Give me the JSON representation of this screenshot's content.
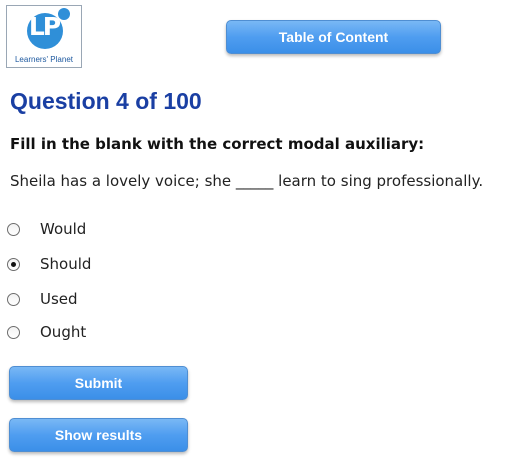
{
  "logo": {
    "letters": "LP",
    "caption": "Learners' Planet"
  },
  "header": {
    "toc_label": "Table of Content"
  },
  "question": {
    "heading": "Question 4 of 100",
    "instruction": "Fill in the blank with the correct modal auxiliary:",
    "sentence": "Sheila has a lovely voice; she _____ learn to sing professionally."
  },
  "options": [
    {
      "label": "Would",
      "selected": false
    },
    {
      "label": "Should",
      "selected": true
    },
    {
      "label": "Used",
      "selected": false
    },
    {
      "label": "Ought",
      "selected": false
    }
  ],
  "actions": {
    "submit_label": "Submit",
    "show_results_label": "Show results"
  },
  "colors": {
    "heading": "#1a3fa3",
    "button": "#4f9df0",
    "logo": "#2f8fd8"
  },
  "icons": {
    "logo": "learners-planet-logo",
    "radio": "radio-button"
  }
}
